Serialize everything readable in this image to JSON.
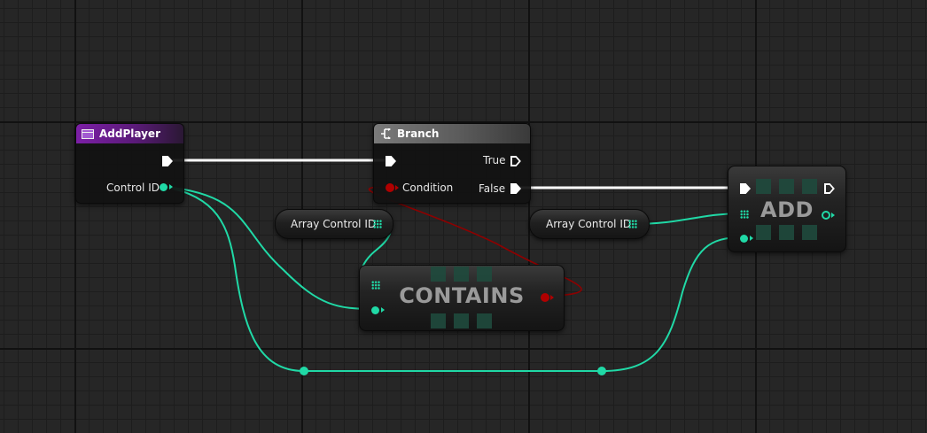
{
  "graph": {
    "add_player_node": {
      "title": "AddPlayer",
      "pins": {
        "control_id": "Control ID"
      }
    },
    "branch_node": {
      "title": "Branch",
      "pins": {
        "true": "True",
        "false": "False",
        "condition": "Condition"
      }
    },
    "var_array_control_id_1": {
      "label": "Array Control ID"
    },
    "var_array_control_id_2": {
      "label": "Array Control ID"
    },
    "contains_node": {
      "title": "CONTAINS"
    },
    "add_node": {
      "title": "ADD"
    }
  },
  "colors": {
    "exec_wire": "#ffffff",
    "int_wire": "#20d9a6",
    "bool_wire": "#b00000",
    "function_header": "#7c1fa6",
    "flow_header": "#6b6b6b"
  },
  "icons": {
    "add_player": "function-icon",
    "branch": "branch-icon"
  }
}
